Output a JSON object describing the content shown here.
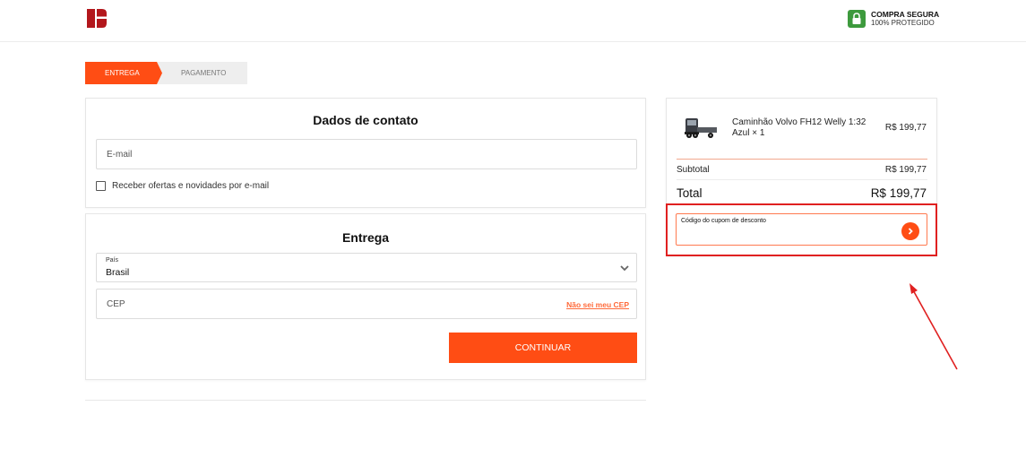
{
  "header": {
    "secure_title": "COMPRA SEGURA",
    "secure_subtitle": "100% PROTEGIDO"
  },
  "steps": {
    "delivery": "ENTREGA",
    "payment": "PAGAMENTO"
  },
  "contact": {
    "title": "Dados de contato",
    "email_placeholder": "E-mail",
    "newsletter_label": "Receber ofertas e novidades por e-mail"
  },
  "delivery": {
    "title": "Entrega",
    "country_label": "País",
    "country_value": "Brasil",
    "cep_placeholder": "CEP",
    "cep_help_link": "Não sei meu CEP",
    "continue_label": "CONTINUAR"
  },
  "summary": {
    "product_name": "Caminhão Volvo FH12 Welly 1:32 Azul × 1",
    "product_price": "R$ 199,77",
    "subtotal_label": "Subtotal",
    "subtotal_value": "R$ 199,77",
    "total_label": "Total",
    "total_value": "R$ 199,77",
    "coupon_label": "Código do cupom de desconto"
  },
  "colors": {
    "accent": "#ff4d14",
    "brand_logo": "#b3171c",
    "secure_green": "#3d9a3d",
    "highlight_red": "#e02020"
  },
  "icons": {
    "logo": "brand-logo-icon",
    "secure": "lock-shield-icon",
    "country_select": "chevron-down-icon",
    "coupon_submit": "chevron-right-icon",
    "product": "truck-product-icon"
  }
}
